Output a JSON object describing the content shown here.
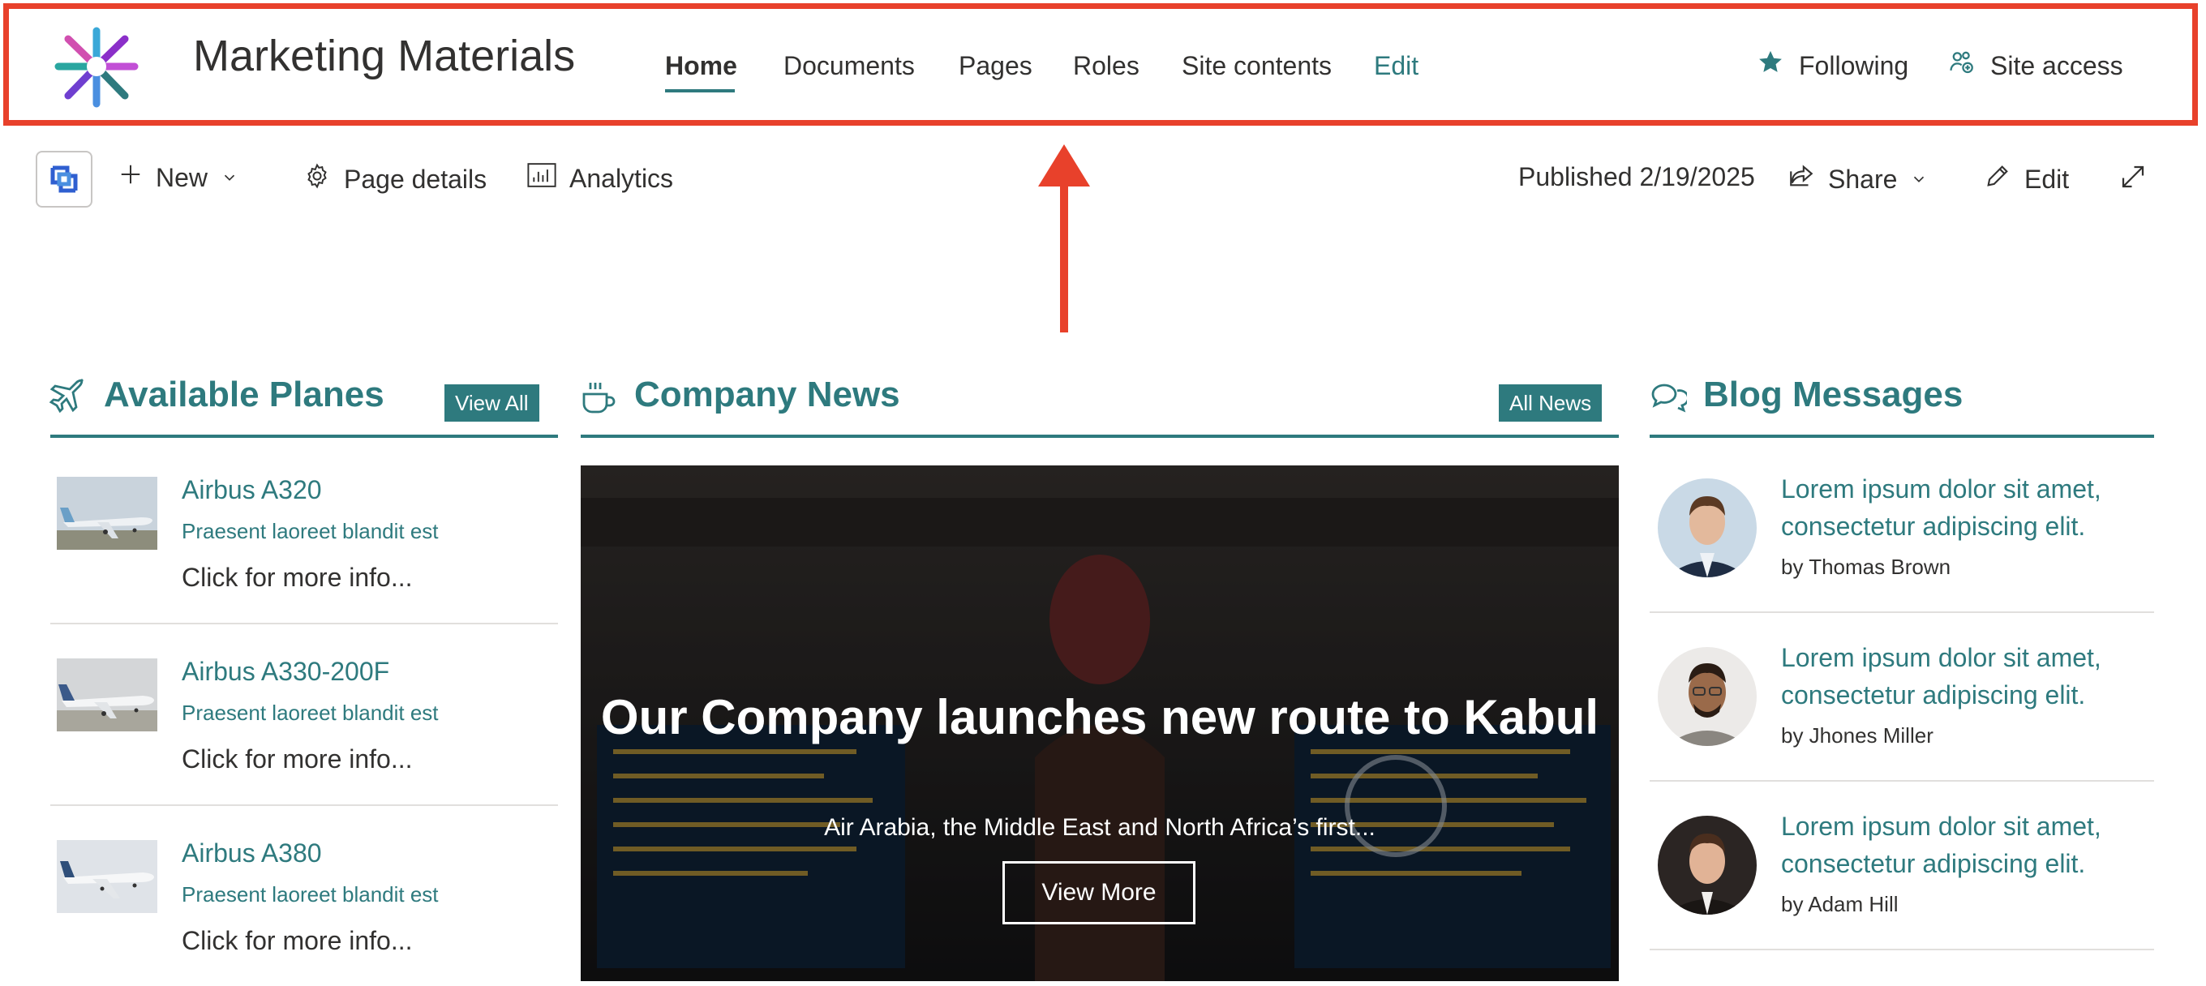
{
  "header": {
    "site_title": "Marketing Materials",
    "nav": [
      "Home",
      "Documents",
      "Pages",
      "Roles",
      "Site contents",
      "Edit"
    ],
    "following_label": "Following",
    "site_access_label": "Site access",
    "icons": {
      "following": "star-icon",
      "site_access": "people-settings-icon",
      "logo": "starburst-logo-icon"
    }
  },
  "commandbar": {
    "new_label": "New",
    "page_details_label": "Page details",
    "analytics_label": "Analytics",
    "published_label": "Published 2/19/2025",
    "share_label": "Share",
    "edit_label": "Edit"
  },
  "planes": {
    "title": "Available Planes",
    "view_all_label": "View All",
    "items": [
      {
        "name": "Airbus A320",
        "subtitle": "Praesent laoreet blandit est",
        "more": "Click for more info..."
      },
      {
        "name": "Airbus A330-200F",
        "subtitle": "Praesent laoreet blandit est",
        "more": "Click for more info..."
      },
      {
        "name": "Airbus A380",
        "subtitle": "Praesent laoreet blandit est",
        "more": "Click for more info..."
      }
    ]
  },
  "news": {
    "title": "Company News",
    "all_news_label": "All News",
    "headline": "Our Company launches new route to Kabul",
    "summary": "Air Arabia, the Middle East and North Africa’s first...",
    "view_more_label": "View More"
  },
  "blog": {
    "title": "Blog Messages",
    "items": [
      {
        "text": "Lorem ipsum dolor sit amet, consectetur adipiscing elit.",
        "author": "by Thomas Brown"
      },
      {
        "text": "Lorem ipsum dolor sit amet, consectetur adipiscing elit.",
        "author": "by Jhones Miller"
      },
      {
        "text": "Lorem ipsum dolor sit amet, consectetur adipiscing elit.",
        "author": "by Adam Hill"
      }
    ]
  },
  "colors": {
    "accent": "#2e7a7e",
    "annotation": "#e8412b"
  }
}
